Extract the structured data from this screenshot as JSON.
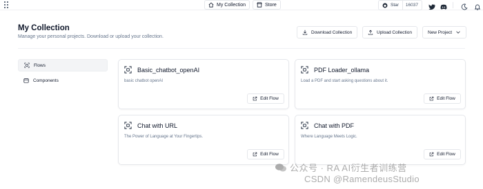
{
  "nav": {
    "my_collection": "My Collection",
    "store": "Store",
    "github_star": "Star",
    "github_count": "16037"
  },
  "header": {
    "title": "My Collection",
    "subtitle": "Manage your personal projects. Download or upload your collection.",
    "download": "Download Collection",
    "upload": "Upload Collection",
    "new_project": "New Project"
  },
  "sidebar": {
    "items": [
      {
        "label": "Flows",
        "icon": "flows-icon",
        "active": true
      },
      {
        "label": "Components",
        "icon": "components-icon",
        "active": false
      }
    ]
  },
  "cards": [
    {
      "title": "Basic_chatbot_openAI",
      "desc": "basic chatbot openAI",
      "action": "Edit Flow"
    },
    {
      "title": "PDF Loader_ollama",
      "desc": "Load a PDF and start asking questions about it.",
      "action": "Edit Flow"
    },
    {
      "title": "Chat with URL",
      "desc": "The Power of Language at Your Fingertips.",
      "action": "Edit Flow"
    },
    {
      "title": "Chat with PDF",
      "desc": "Where Language Meets Logic.",
      "action": "Edit Flow"
    }
  ],
  "watermark": {
    "line1": "公众号 · RA AI衍生者训练营",
    "line2": "CSDN @RamendeusStudio"
  },
  "colors": {
    "border": "#e5e7eb",
    "text": "#0f172a",
    "muted": "#64748b",
    "active_bg": "#f3f4f6"
  }
}
